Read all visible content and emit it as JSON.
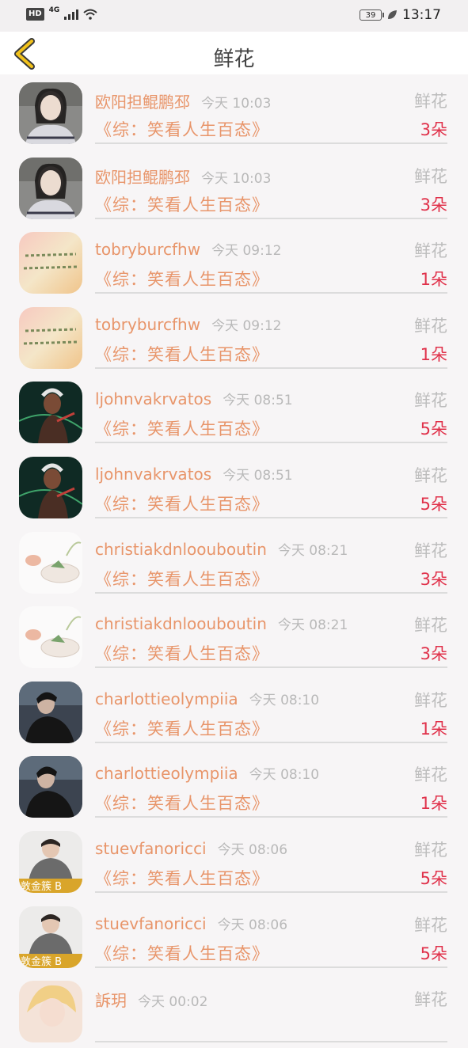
{
  "status": {
    "hd": "HD",
    "network": "4G",
    "battery": "39",
    "time": "13:17"
  },
  "header": {
    "title": "鲜花"
  },
  "colors": {
    "name": "#e8956a",
    "count": "#e0314a",
    "muted": "#bdbdbd"
  },
  "rows": [
    {
      "name": "欧阳担鲲鹏邳",
      "time": "今天 10:03",
      "book": "《综：笑看人生百态》",
      "type": "鲜花",
      "count": "3朵",
      "avatar": "girl-photo"
    },
    {
      "name": "欧阳担鲲鹏邳",
      "time": "今天 10:03",
      "book": "《综：笑看人生百态》",
      "type": "鲜花",
      "count": "3朵",
      "avatar": "girl-photo"
    },
    {
      "name": "tobryburcfhw",
      "time": "今天 09:12",
      "book": "《综：笑看人生百态》",
      "type": "鲜花",
      "count": "1朵",
      "avatar": "text-art"
    },
    {
      "name": "tobryburcfhw",
      "time": "今天 09:12",
      "book": "《综：笑看人生百态》",
      "type": "鲜花",
      "count": "1朵",
      "avatar": "text-art"
    },
    {
      "name": "ljohnvakrvatos",
      "time": "今天 08:51",
      "book": "《综：笑看人生百态》",
      "type": "鲜花",
      "count": "5朵",
      "avatar": "game-character"
    },
    {
      "name": "ljohnvakrvatos",
      "time": "今天 08:51",
      "book": "《综：笑看人生百态》",
      "type": "鲜花",
      "count": "5朵",
      "avatar": "game-character"
    },
    {
      "name": "christiakdnloouboutin",
      "time": "今天 08:21",
      "book": "《综：笑看人生百态》",
      "type": "鲜花",
      "count": "3朵",
      "avatar": "tea-bowl"
    },
    {
      "name": "christiakdnloouboutin",
      "time": "今天 08:21",
      "book": "《综：笑看人生百态》",
      "type": "鲜花",
      "count": "3朵",
      "avatar": "tea-bowl"
    },
    {
      "name": "charlottieolympiia",
      "time": "今天 08:10",
      "book": "《综：笑看人生百态》",
      "type": "鲜花",
      "count": "1朵",
      "avatar": "dark-portrait"
    },
    {
      "name": "charlottieolympiia",
      "time": "今天 08:10",
      "book": "《综：笑看人生百态》",
      "type": "鲜花",
      "count": "1朵",
      "avatar": "dark-portrait"
    },
    {
      "name": "stuevfanoricci",
      "time": "今天 08:06",
      "book": "《综：笑看人生百态》",
      "type": "鲜花",
      "count": "5朵",
      "avatar": "hoodie-boy"
    },
    {
      "name": "stuevfanoricci",
      "time": "今天 08:06",
      "book": "《综：笑看人生百态》",
      "type": "鲜花",
      "count": "5朵",
      "avatar": "hoodie-boy"
    },
    {
      "name": "訴玥",
      "time": "今天 00:02",
      "book": "",
      "type": "鲜花",
      "count": "",
      "avatar": "anime-blond"
    }
  ]
}
